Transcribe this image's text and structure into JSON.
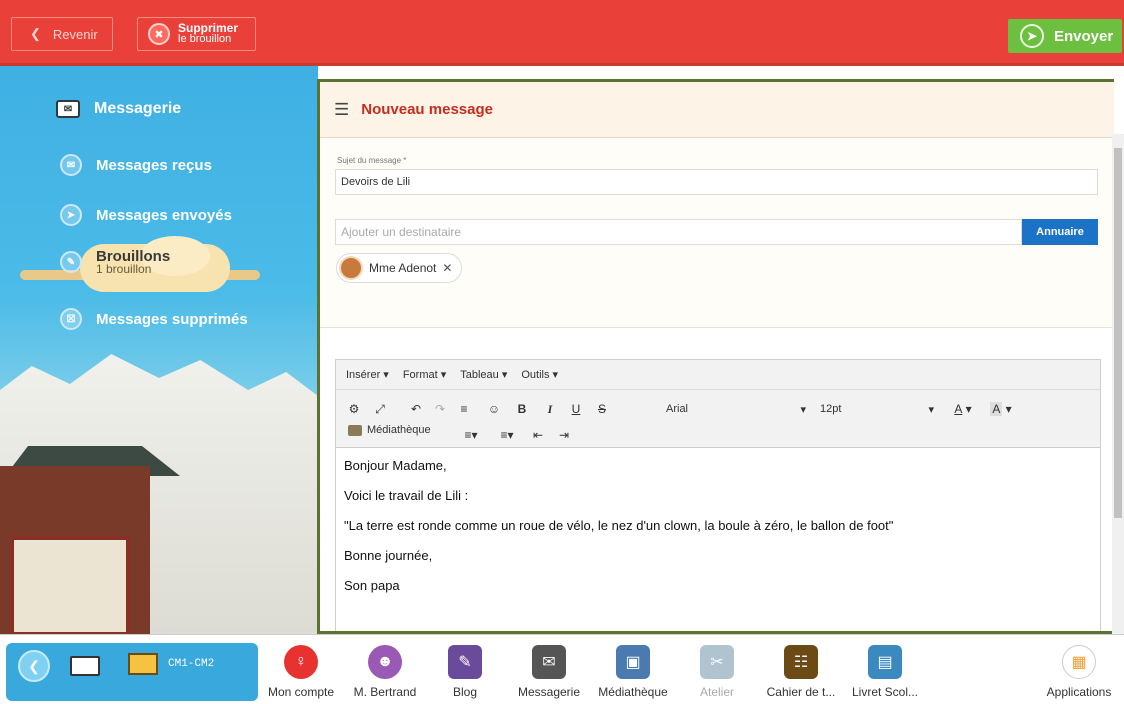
{
  "topbar": {
    "back_label": "Revenir",
    "delete_line1": "Supprimer",
    "delete_line2": "le brouillon",
    "send_label": "Envoyer"
  },
  "sidebar": {
    "title": "Messagerie",
    "items": [
      {
        "label": "Messages reçus",
        "icon": "inbox-icon"
      },
      {
        "label": "Messages envoyés",
        "icon": "sent-icon"
      },
      {
        "label": "Brouillons",
        "sub": "1 brouillon",
        "icon": "drafts-icon"
      },
      {
        "label": "Messages supprimés",
        "icon": "trash-icon"
      }
    ]
  },
  "main": {
    "title": "Nouveau message",
    "subject_label": "Sujet du message *",
    "subject_value": "Devoirs de Lili",
    "recipient_placeholder": "Ajouter un destinataire",
    "annuaire_label": "Annuaire",
    "recipients": [
      {
        "name": "Mme Adenot"
      }
    ]
  },
  "editor": {
    "menus": [
      "Insérer",
      "Format",
      "Tableau",
      "Outils"
    ],
    "font": "Arial",
    "size": "12pt",
    "media_label": "Médiathèque",
    "content": [
      "Bonjour Madame,",
      "Voici le travail de Lili :",
      "\"La terre est ronde comme un roue de vélo, le nez d'un clown, la boule à zéro, le ballon de foot\"",
      "Bonne journée,",
      "Son papa"
    ]
  },
  "bottombar": {
    "class_label": "CM1-CM2",
    "apps": [
      {
        "label": "Mon compte",
        "color": "#e8322f"
      },
      {
        "label": "M. Bertrand",
        "color": "#9b59b6"
      },
      {
        "label": "Blog",
        "color": "#6a4a9a"
      },
      {
        "label": "Messagerie",
        "color": "#555555"
      },
      {
        "label": "Médiathèque",
        "color": "#4a7ab0"
      },
      {
        "label": "Atelier",
        "color": "#b0c4d0",
        "dim": true
      },
      {
        "label": "Cahier de t...",
        "color": "#6b4a16"
      },
      {
        "label": "Livret Scol...",
        "color": "#3a8ac0"
      },
      {
        "label": "Applications",
        "color": "#f0a030"
      }
    ]
  }
}
